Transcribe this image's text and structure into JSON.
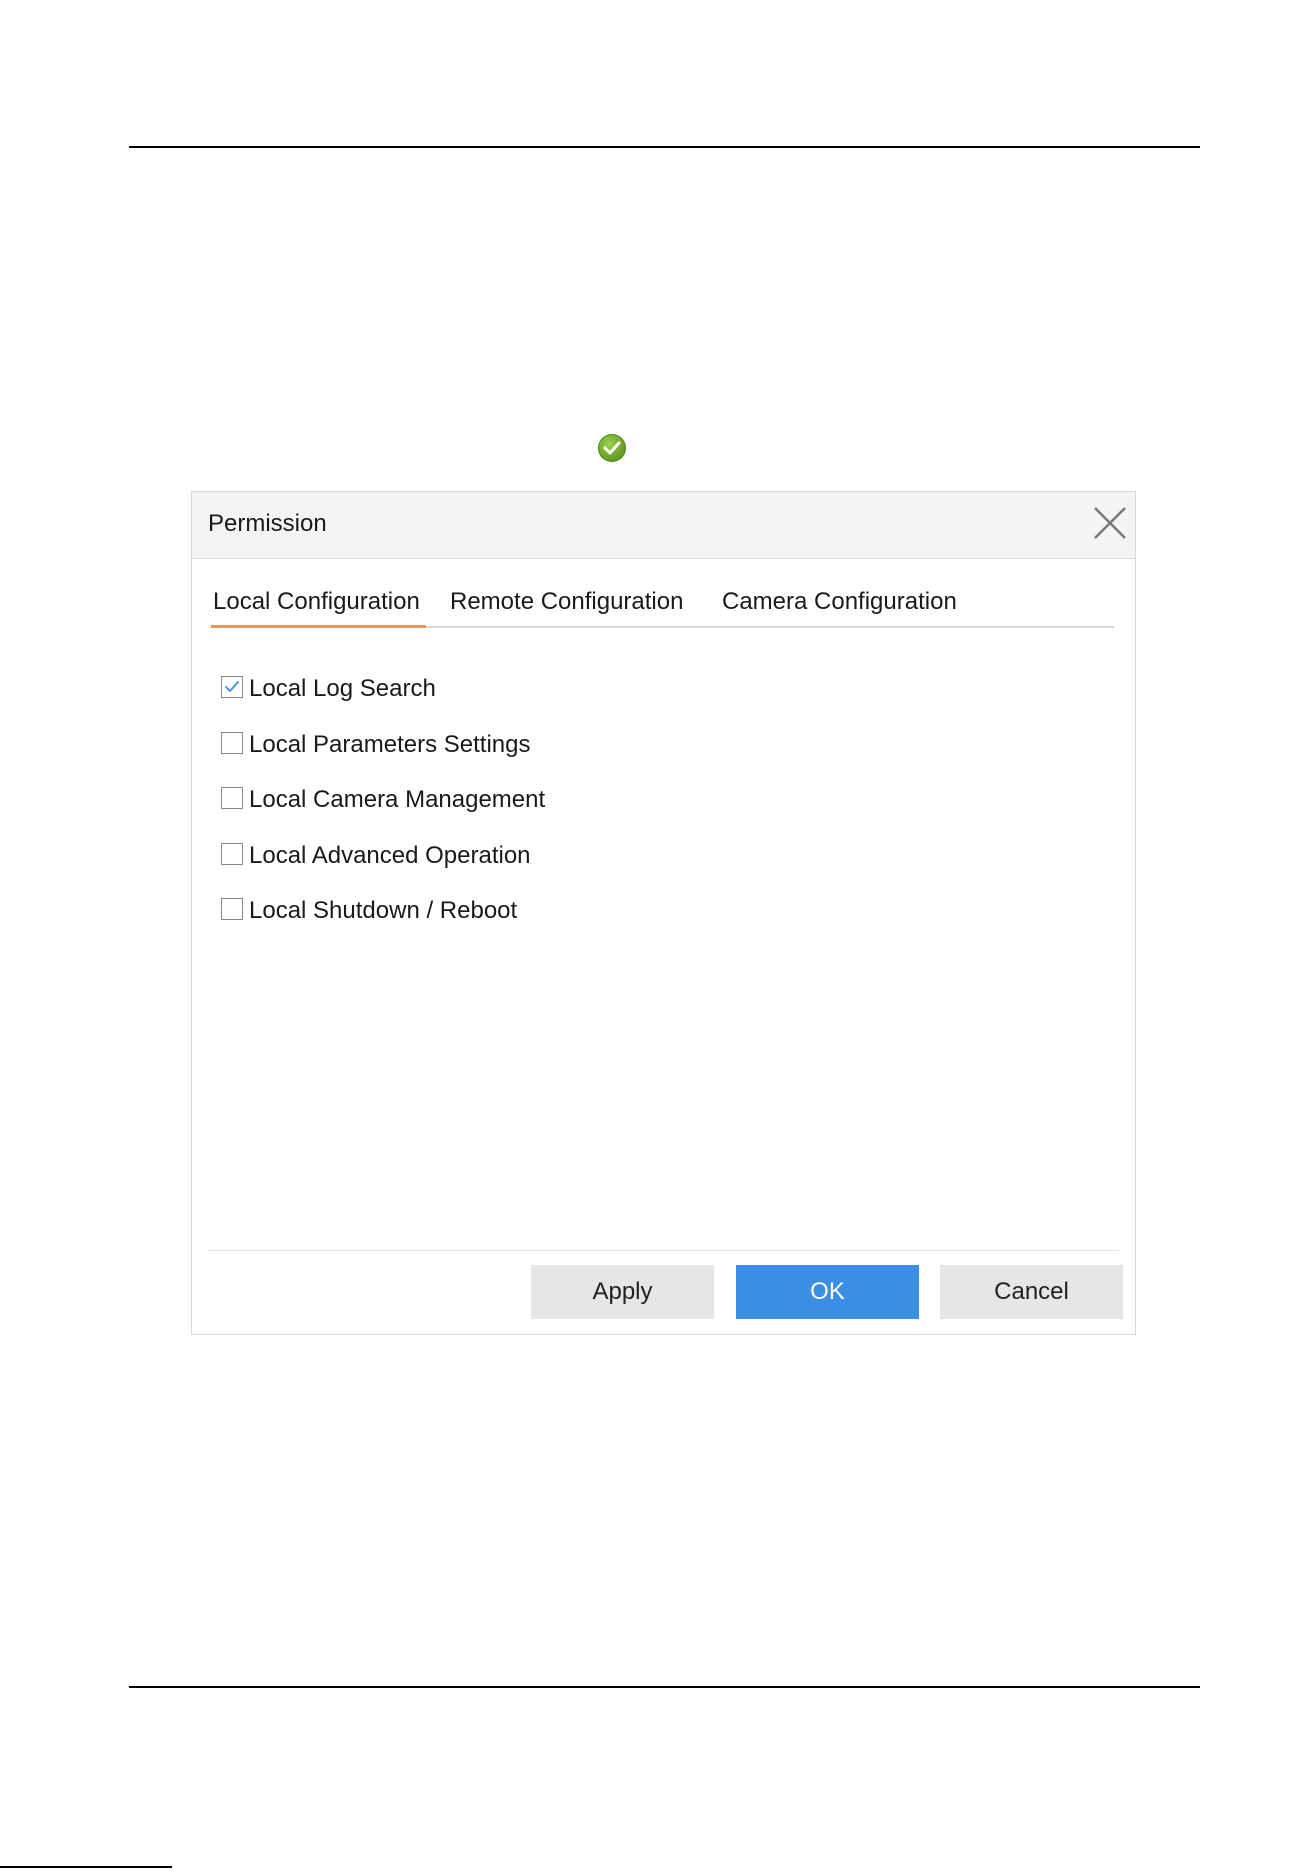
{
  "dialog": {
    "title": "Permission",
    "close_icon": "close-icon"
  },
  "status_icon": "check-circle-icon",
  "tabs": [
    {
      "label": "Local Configuration",
      "active": true
    },
    {
      "label": "Remote Configuration",
      "active": false
    },
    {
      "label": "Camera Configuration",
      "active": false
    }
  ],
  "permissions": [
    {
      "label": "Local Log Search",
      "checked": true
    },
    {
      "label": "Local Parameters Settings",
      "checked": false
    },
    {
      "label": "Local Camera Management",
      "checked": false
    },
    {
      "label": "Local Advanced Operation",
      "checked": false
    },
    {
      "label": "Local Shutdown / Reboot",
      "checked": false
    }
  ],
  "buttons": {
    "apply": "Apply",
    "ok": "OK",
    "cancel": "Cancel"
  },
  "colors": {
    "primary": "#3a8ee6",
    "tab_underline": "#e7965a",
    "check_mark": "#3a8ee6",
    "status_green": "#6aa52a"
  }
}
